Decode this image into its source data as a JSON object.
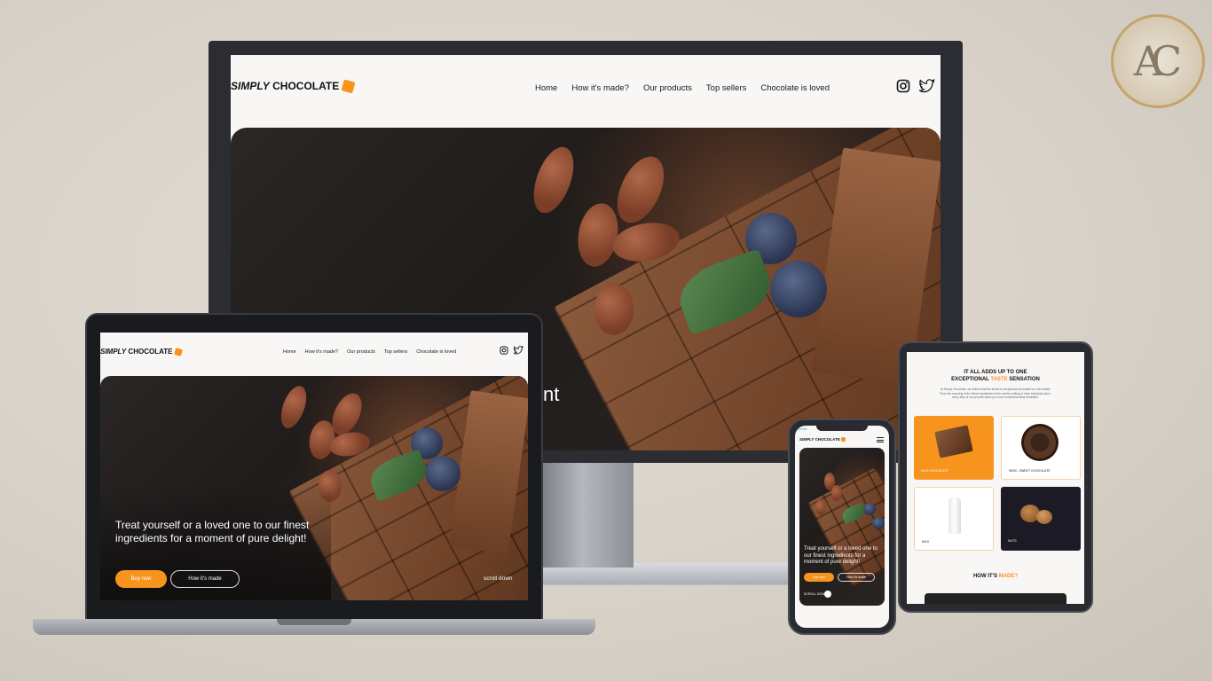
{
  "brand": {
    "logo_italic": "SIMPLY",
    "logo_bold": "CHOCOLATE",
    "monogram": "AC",
    "accent_color": "#f7941d"
  },
  "nav": {
    "home": "Home",
    "how": "How it's made?",
    "products": "Our products",
    "top": "Top sellers",
    "loved": "Chocolate is loved",
    "loved_monitor": "Chocolate is loved"
  },
  "social": {
    "instagram": "instagram-icon",
    "twitter": "twitter-icon"
  },
  "hero": {
    "headline": "Treat yourself or a loved one to our finest ingredients for a moment of pure delight!",
    "cta_primary": "Buy now",
    "cta_secondary": "How it's made",
    "scroll": "scroll down",
    "monitor_fragment": "nt"
  },
  "phone": {
    "status_label": "Mobile",
    "scroll": "SCROLL DOWN"
  },
  "tablet": {
    "title_line1": "IT ALL ADDS UP TO ONE",
    "title_line2_pre": "EXCEPTIONAL ",
    "title_line2_accent": "TASTE",
    "title_line2_post": " SENSATION",
    "intro": "At Simply Chocolate, we believe that the secret to exceptional chocolate is in the details. From the sourcing of the finest ingredients to the careful crafting of each individual piece, every step of our process adds up to one exceptional taste sensation.",
    "products": [
      {
        "label": "MILK CHOCOLATE"
      },
      {
        "label": "SEMI - SWEET CHOCOLATE"
      },
      {
        "label": "MILK"
      },
      {
        "label": "NUTS"
      }
    ],
    "how_pre": "HOW IT'S ",
    "how_accent": "MADE?"
  }
}
